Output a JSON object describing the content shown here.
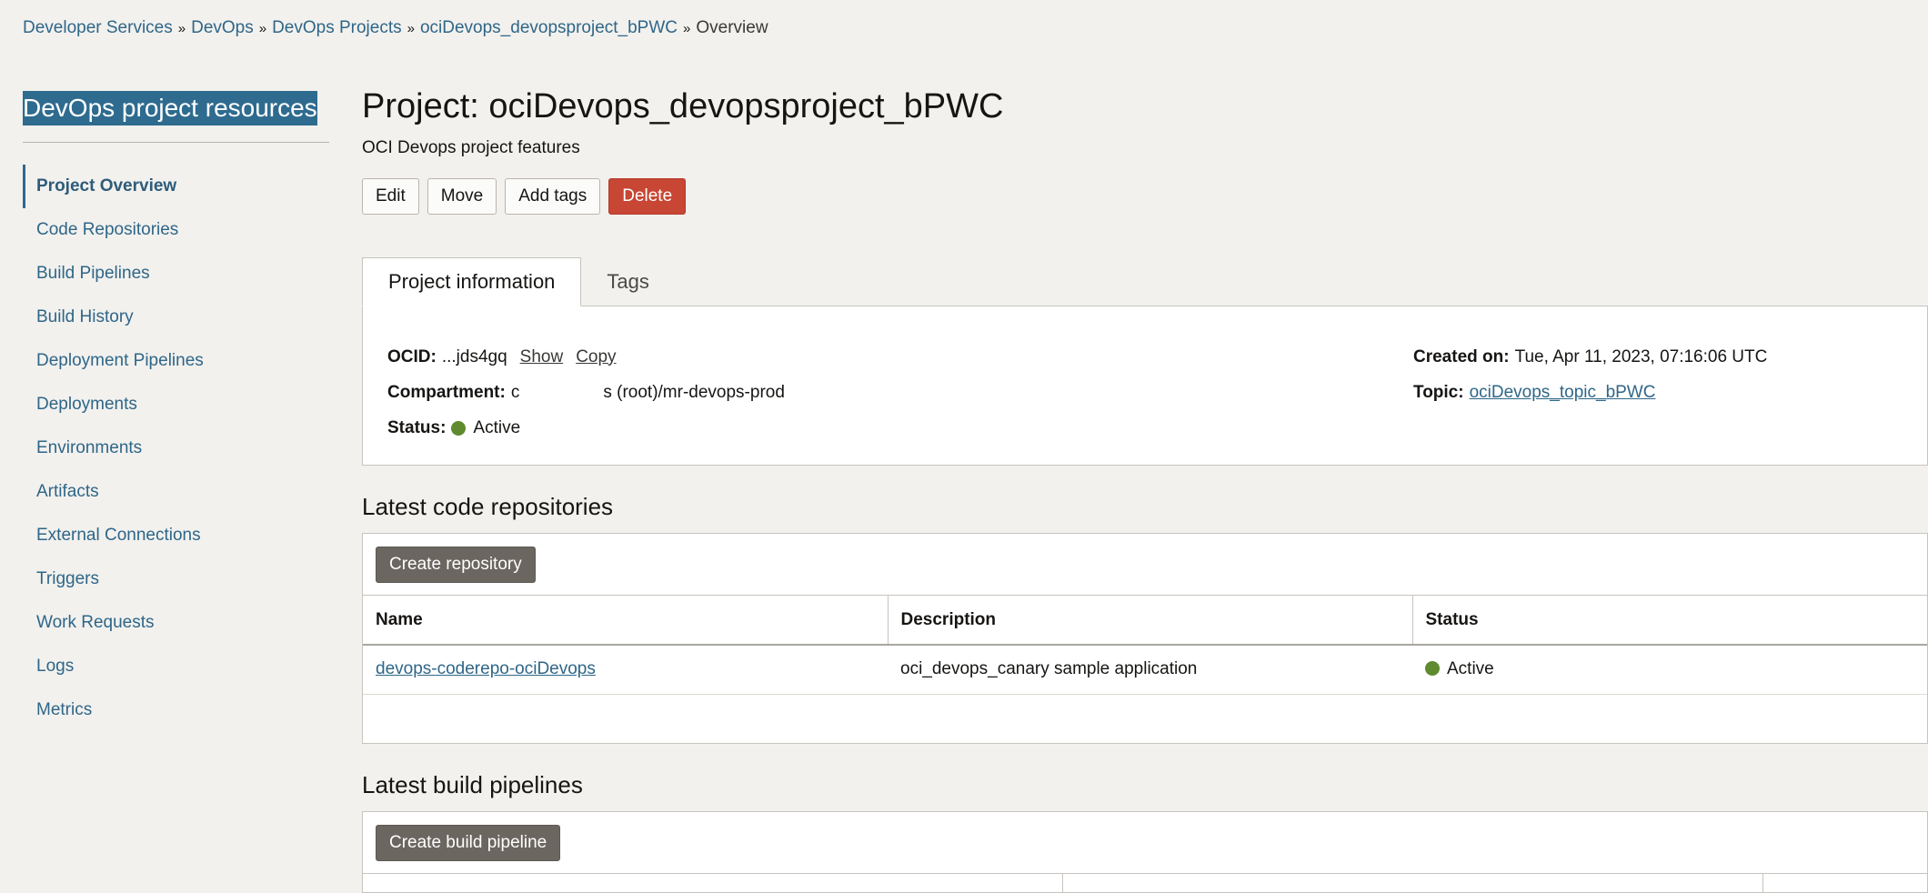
{
  "breadcrumb": {
    "items": [
      "Developer Services",
      "DevOps",
      "DevOps Projects",
      "ociDevops_devopsproject_bPWC"
    ],
    "current": "Overview",
    "separator": "»"
  },
  "sidebar": {
    "title": "DevOps project resources",
    "items": [
      {
        "label": "Project Overview",
        "active": true
      },
      {
        "label": "Code Repositories"
      },
      {
        "label": "Build Pipelines"
      },
      {
        "label": "Build History"
      },
      {
        "label": "Deployment Pipelines"
      },
      {
        "label": "Deployments"
      },
      {
        "label": "Environments"
      },
      {
        "label": "Artifacts"
      },
      {
        "label": "External Connections"
      },
      {
        "label": "Triggers"
      },
      {
        "label": "Work Requests"
      },
      {
        "label": "Logs"
      },
      {
        "label": "Metrics"
      }
    ]
  },
  "page": {
    "title": "Project: ociDevops_devopsproject_bPWC",
    "subtitle": "OCI Devops project features"
  },
  "actions": {
    "edit": "Edit",
    "move": "Move",
    "add_tags": "Add tags",
    "delete": "Delete"
  },
  "tabs": {
    "project_info": "Project information",
    "tags": "Tags"
  },
  "info": {
    "ocid_label": "OCID:",
    "ocid_value": "...jds4gq",
    "show": "Show",
    "copy": "Copy",
    "compartment_label": "Compartment:",
    "compartment_prefix": "c",
    "compartment_suffix": "s (root)/mr-devops-prod",
    "status_label": "Status:",
    "status_value": "Active",
    "created_label": "Created on:",
    "created_value": "Tue, Apr 11, 2023, 07:16:06 UTC",
    "topic_label": "Topic:",
    "topic_value": "ociDevops_topic_bPWC"
  },
  "repos": {
    "section_title": "Latest code repositories",
    "create_button": "Create repository",
    "columns": {
      "name": "Name",
      "description": "Description",
      "status": "Status"
    },
    "rows": [
      {
        "name": "devops-coderepo-ociDevops",
        "description": "oci_devops_canary sample application",
        "status": "Active"
      }
    ]
  },
  "pipelines": {
    "section_title": "Latest build pipelines",
    "create_button": "Create build pipeline"
  },
  "colors": {
    "link": "#2f6688",
    "danger": "#c74634",
    "status_active": "#5f8a2e",
    "sidebar_title_bg": "#2e6b8f"
  }
}
